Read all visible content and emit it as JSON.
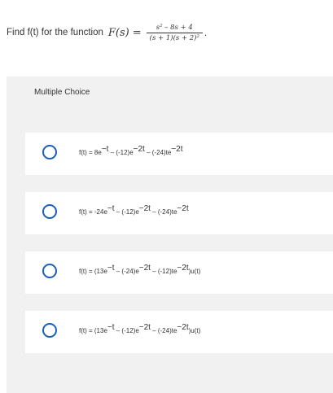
{
  "question": {
    "prefix": "Find f(t) for the function",
    "function_name": "F(s)",
    "equals": "=",
    "numerator": "s² – 8s + 4",
    "denominator": "(s + 1)(s + 2)²",
    "period": "."
  },
  "panel": {
    "header": "Multiple Choice"
  },
  "options": [
    {
      "lead": "f(t) = 8e",
      "e1": "−t",
      "mid1": " – (-12)e",
      "e2": "−2t",
      "mid2": " – (-24)te",
      "e3": "−2t",
      "tail": ""
    },
    {
      "lead": "f(t) = -24e",
      "e1": "−t",
      "mid1": " – (-12)e",
      "e2": "−2t",
      "mid2": " – (-24)te",
      "e3": "−2t",
      "tail": ""
    },
    {
      "lead": "f(t) = (13e",
      "e1": "−t",
      "mid1": " – (-24)e",
      "e2": "−2t",
      "mid2": " – (-12)te",
      "e3": "−2t",
      "tail": ")u(t)"
    },
    {
      "lead": "f(t) = (13e",
      "e1": "−t",
      "mid1": " – (-12)e",
      "e2": "−2t",
      "mid2": " – (-24)te",
      "e3": "−2t",
      "tail": ")u(t)"
    }
  ],
  "colors": {
    "radio_border": "#1b5fbd",
    "panel_background": "#f1f1f1",
    "text": "#333333"
  }
}
